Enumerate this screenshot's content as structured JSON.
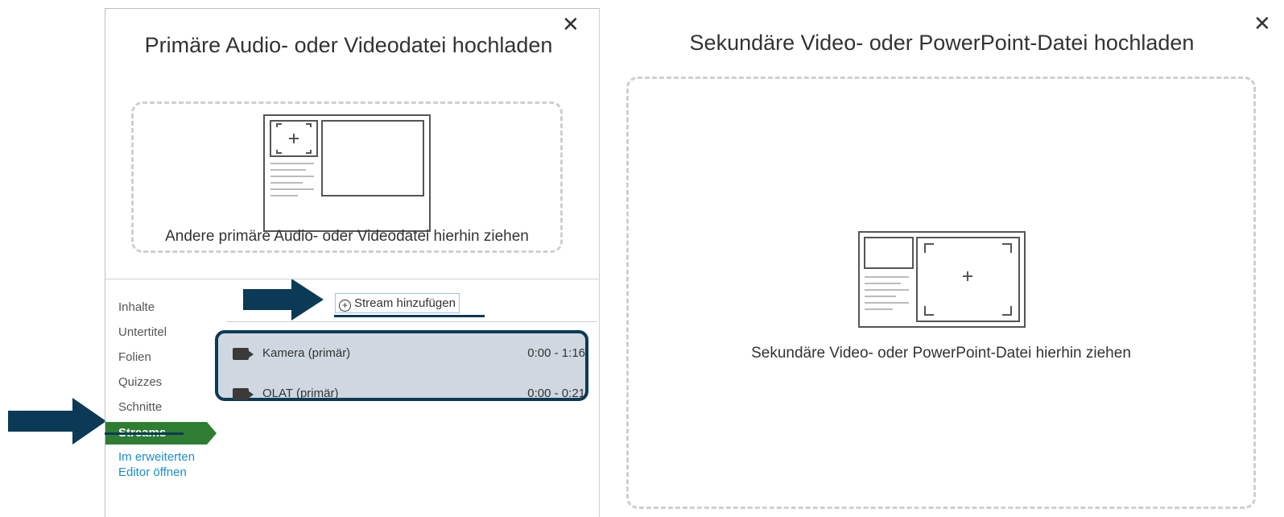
{
  "primary": {
    "title": "Primäre Audio- oder Videodatei hochladen",
    "drop_label": "Andere primäre Audio- oder Videodatei hierhin ziehen",
    "close_label": "✕"
  },
  "secondary": {
    "title": "Sekundäre Video- oder PowerPoint-Datei hochladen",
    "drop_label": "Sekundäre Video- oder PowerPoint-Datei hierhin ziehen",
    "close_label": "✕"
  },
  "nav": {
    "items": [
      {
        "label": "Inhalte"
      },
      {
        "label": "Untertitel"
      },
      {
        "label": "Folien"
      },
      {
        "label": "Quizzes"
      },
      {
        "label": "Schnitte"
      },
      {
        "label": "Streams",
        "active": true
      }
    ],
    "link_label": "Im erweiterten Editor öffnen"
  },
  "streams": {
    "add_label": "Stream hinzufügen",
    "rows": [
      {
        "name": "Kamera (primär)",
        "time": "0:00 - 1:16",
        "icon": "video-camera-icon"
      },
      {
        "name": "OLAT (primär)",
        "time": "0:00 - 0:21",
        "icon": "video-camera-icon"
      }
    ]
  },
  "colors": {
    "accent_navy": "#0b3a56",
    "active_green": "#2e7d32",
    "link_blue": "#1a8fc9",
    "stream_bg": "#cfd8e0"
  }
}
